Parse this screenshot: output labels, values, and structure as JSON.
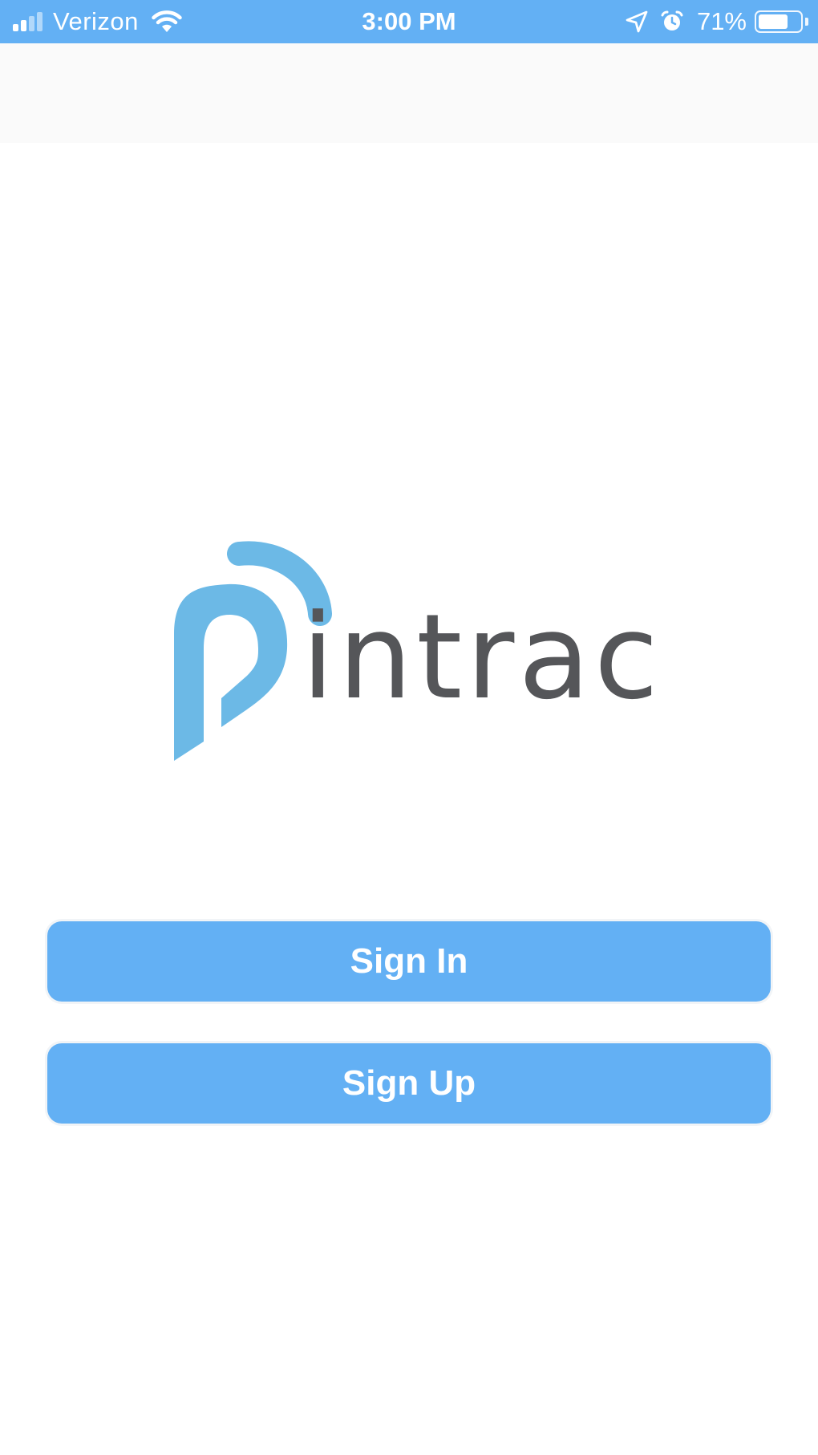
{
  "status_bar": {
    "carrier": "Verizon",
    "time": "3:00 PM",
    "battery_percent_label": "71%",
    "battery_level": 0.71,
    "background_color": "#63b0f4",
    "icons": [
      "signal-icon",
      "wifi-icon",
      "location-arrow-icon",
      "alarm-icon",
      "battery-icon"
    ]
  },
  "logo": {
    "text": "intrac",
    "letter_p_color": "#6cb9e6",
    "text_color": "#555659"
  },
  "actions": {
    "sign_in_label": "Sign In",
    "sign_up_label": "Sign Up",
    "button_color": "#63b0f4"
  }
}
